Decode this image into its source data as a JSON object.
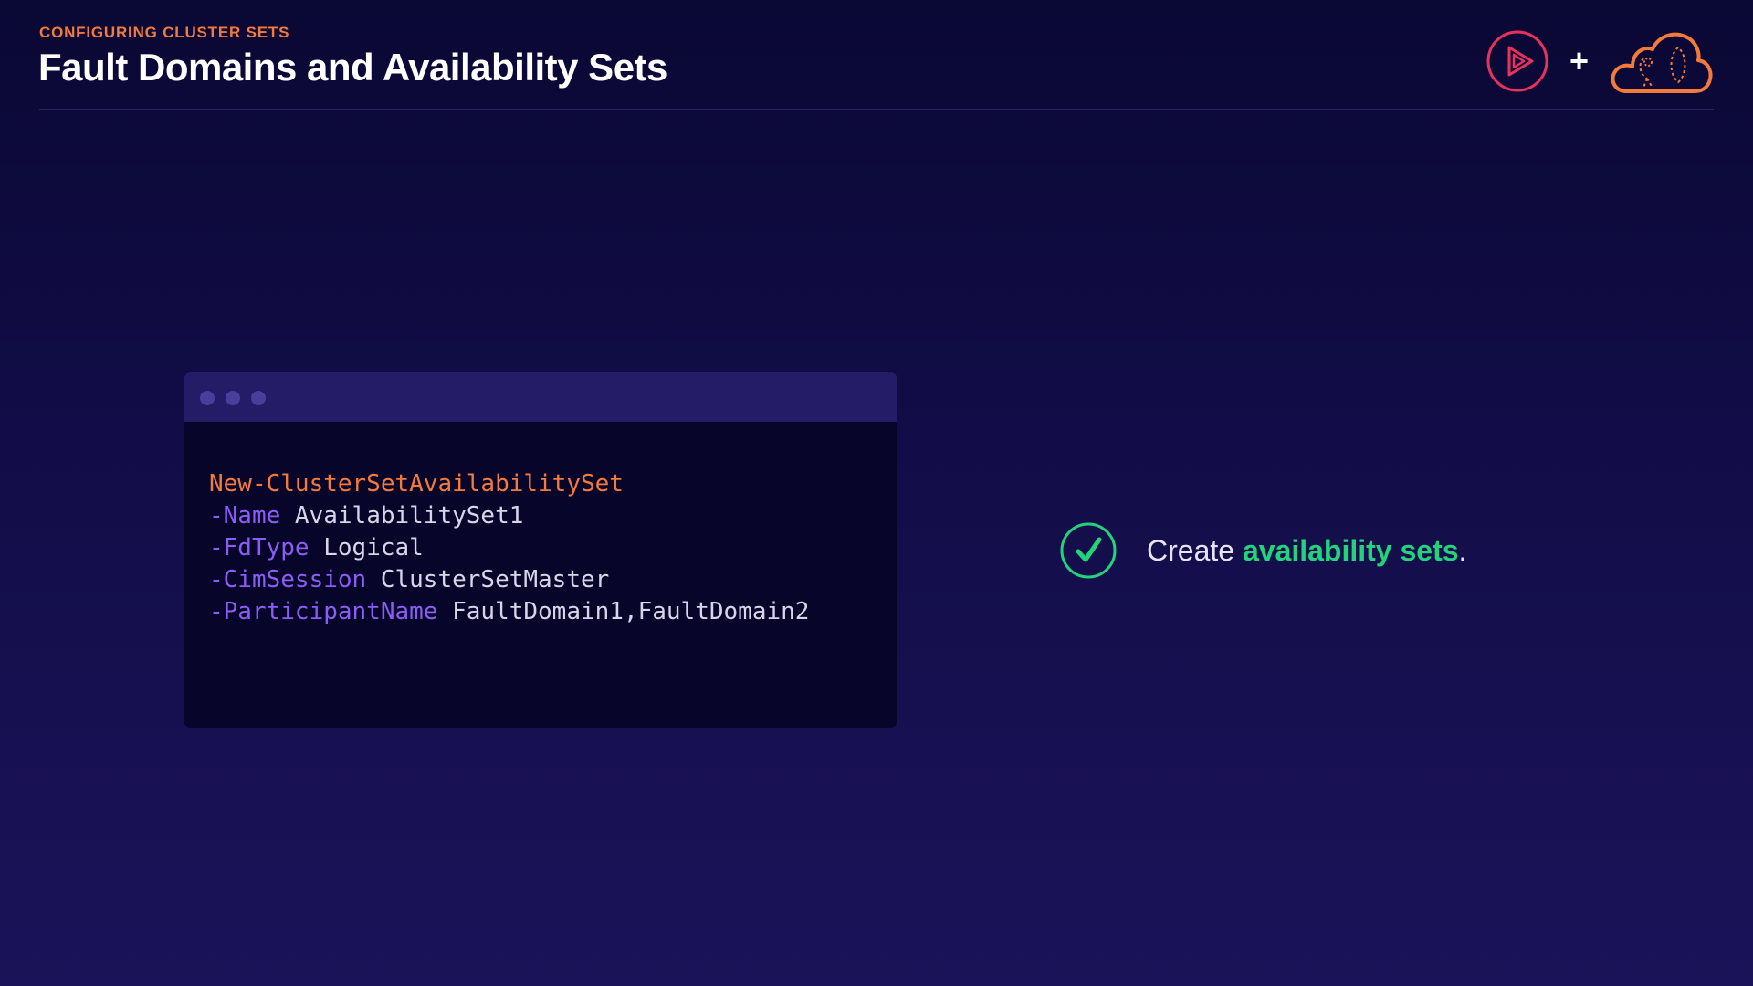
{
  "header": {
    "section_label": "CONFIGURING CLUSTER SETS",
    "title": "Fault Domains and Availability Sets",
    "plus": "+"
  },
  "logos": {
    "left_icon": "play-logo-icon",
    "right_icon": "cloud-logo-icon"
  },
  "code_window": {
    "dots": [
      "window-dot",
      "window-dot",
      "window-dot"
    ],
    "lines": [
      {
        "parts": [
          {
            "text": "New-ClusterSetAvailabilitySet",
            "kind": "cmdlet"
          }
        ]
      },
      {
        "parts": [
          {
            "text": "-Name",
            "kind": "param"
          },
          {
            "text": " AvailabilitySet1",
            "kind": "value"
          }
        ]
      },
      {
        "parts": [
          {
            "text": "-FdType",
            "kind": "param"
          },
          {
            "text": " Logical",
            "kind": "value"
          }
        ]
      },
      {
        "parts": [
          {
            "text": "-CimSession",
            "kind": "param"
          },
          {
            "text": " ClusterSetMaster",
            "kind": "value"
          }
        ]
      },
      {
        "parts": [
          {
            "text": "-ParticipantName",
            "kind": "param"
          },
          {
            "text": " FaultDomain1,FaultDomain2",
            "kind": "value"
          }
        ]
      }
    ]
  },
  "bullet": {
    "icon": "check-circle-icon",
    "prefix": "Create ",
    "highlight": "availability sets",
    "suffix": "."
  },
  "colors": {
    "accent_orange": "#f47a3b",
    "param_purple": "#8b5cf6",
    "highlight_green": "#22d37b",
    "play_logo_pink": "#e8315b"
  }
}
